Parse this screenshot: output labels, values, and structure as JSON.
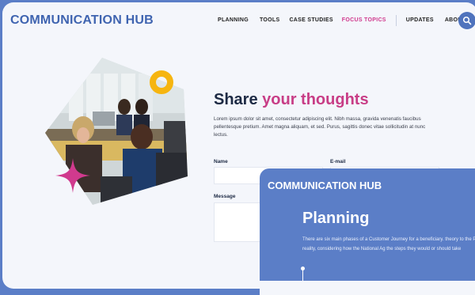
{
  "site": {
    "brand": "COMMUNICATION HUB"
  },
  "nav": {
    "items": [
      {
        "label": "PLANNING"
      },
      {
        "label": "TOOLS"
      },
      {
        "label": "CASE STUDIES"
      },
      {
        "label": "FOCUS TOPICS"
      },
      {
        "label": "UPDATES"
      },
      {
        "label": "ABOUT"
      }
    ],
    "active_color": "#d03a8e",
    "search_icon": "search-icon"
  },
  "hero": {
    "image_alt": "office-people-photo",
    "decor_ring_color": "#f6b510",
    "decor_star_color": "#d03a8e"
  },
  "form": {
    "heading_plain": "Share ",
    "heading_accent": "your thoughts",
    "intro": "Lorem ipsum dolor sit amet, consectetur adipiscing elit. Nibh massa, gravida venenatis faucibus pellentesque pretium. Amet magna aliquam, et sed. Purus, sagittis donec vitae sollicitudin at nunc lectus.",
    "name_label": "Name",
    "email_label": "E-mail",
    "message_label": "Message"
  },
  "overlay": {
    "brand": "COMMUNICATION HUB",
    "title": "Planning",
    "text": "There are six main phases of a Customer Journey for a beneficiary. theory to the Programme reality, considering how the National Ag the steps they would or should take"
  }
}
